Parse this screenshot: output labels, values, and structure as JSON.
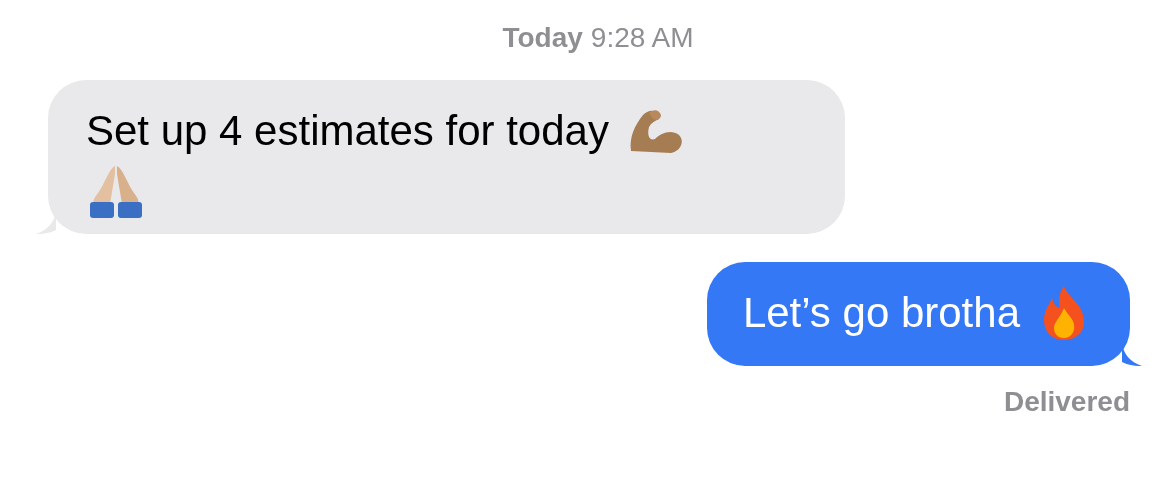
{
  "timestamp": {
    "day": "Today",
    "time": "9:28 AM"
  },
  "messages": [
    {
      "kind": "incoming",
      "text": "Set up 4 estimates for today"
    },
    {
      "kind": "outgoing",
      "text": "Let’s go brotha"
    }
  ],
  "status": "Delivered"
}
